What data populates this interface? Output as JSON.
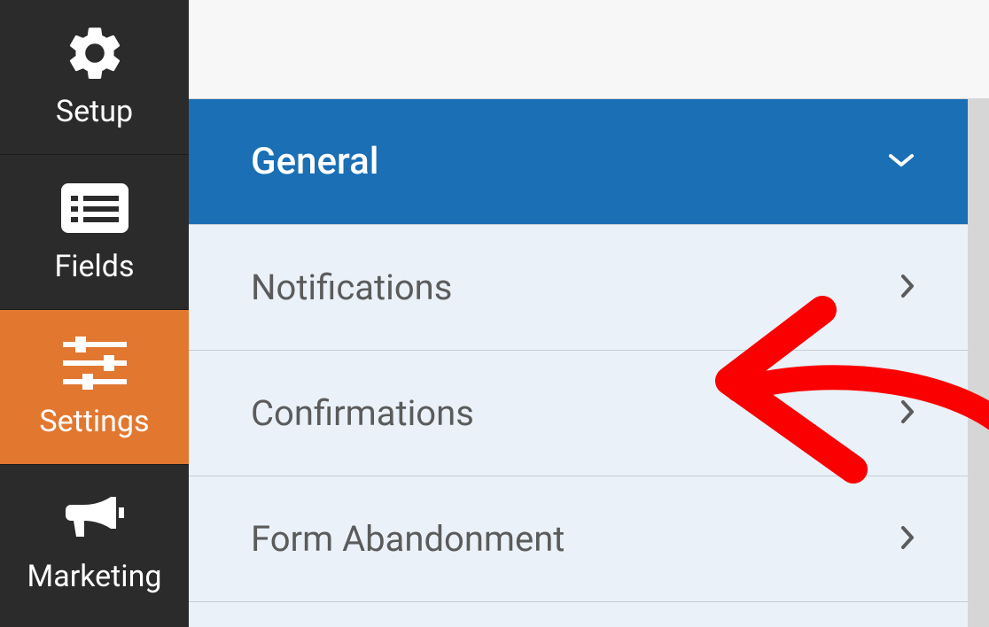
{
  "sidebar": {
    "items": [
      {
        "label": "Setup",
        "icon": "gear"
      },
      {
        "label": "Fields",
        "icon": "list"
      },
      {
        "label": "Settings",
        "icon": "sliders"
      },
      {
        "label": "Marketing",
        "icon": "bullhorn"
      }
    ],
    "active_index": 2
  },
  "settings_panel": {
    "header": {
      "label": "General"
    },
    "rows": [
      {
        "label": "Notifications"
      },
      {
        "label": "Confirmations"
      },
      {
        "label": "Form Abandonment"
      }
    ]
  },
  "annotation": {
    "color": "#fb0000",
    "target_row_index": 1
  }
}
